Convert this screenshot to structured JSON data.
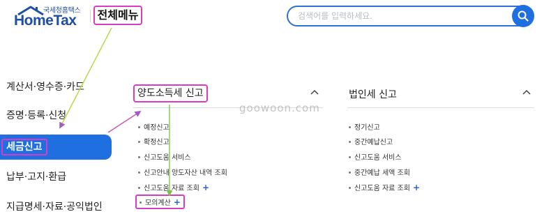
{
  "header": {
    "logo_small": "국세청홈택스",
    "logo_main": "HomeTax",
    "all_menu_label": "전체메뉴",
    "search_placeholder": "검색어를 입력하세요."
  },
  "sidebar": {
    "items": [
      {
        "label": "계산서·영수증·카드",
        "active": false
      },
      {
        "label": "증명·등록·신청",
        "active": false
      },
      {
        "label": "세금신고",
        "active": true
      },
      {
        "label": "납부·고지·환급",
        "active": false
      },
      {
        "label": "지급명세·자료·공익법인",
        "active": false
      }
    ]
  },
  "columns": [
    {
      "title": "양도소득세 신고",
      "items": [
        {
          "label": "예정신고",
          "plus": ""
        },
        {
          "label": "확정신고",
          "plus": ""
        },
        {
          "label": "신고도움 서비스",
          "plus": ""
        },
        {
          "label": "신고안내 양도자산 내역 조회",
          "plus": ""
        },
        {
          "label": "신고도움 자료 조회",
          "plus": "+"
        },
        {
          "label": "모의계산",
          "plus": "+"
        }
      ]
    },
    {
      "title": "법인세 신고",
      "items": [
        {
          "label": "정기신고",
          "plus": ""
        },
        {
          "label": "중간예납신고",
          "plus": ""
        },
        {
          "label": "신고도움 서비스",
          "plus": ""
        },
        {
          "label": "중간예납 세액 조회",
          "plus": ""
        },
        {
          "label": "신고도움 자료 조회",
          "plus": "+"
        }
      ]
    }
  ],
  "watermark": "goowoon.com",
  "colors": {
    "brand_blue": "#1f6fe0",
    "highlight_box": "#d83cc4",
    "logo_blue": "#1e4fa6"
  },
  "icons": {
    "search": "search-icon",
    "chevron": "chevron-up-icon",
    "logo_roof": "house-roof-icon"
  }
}
